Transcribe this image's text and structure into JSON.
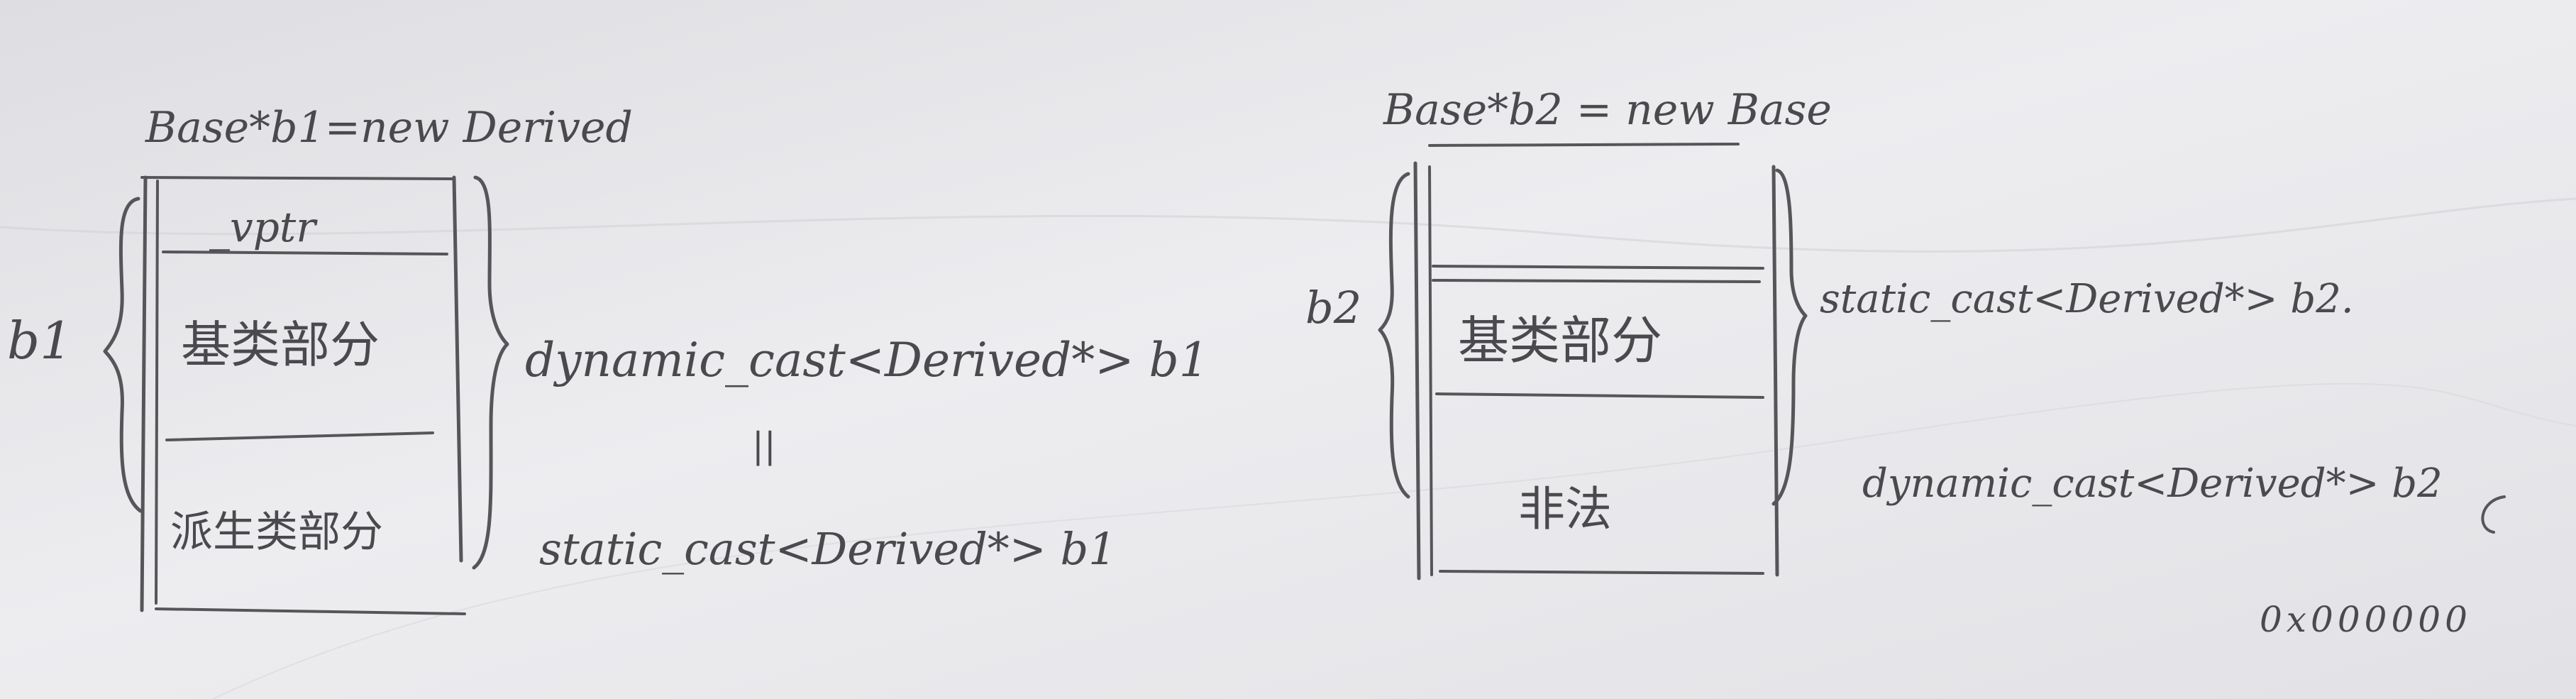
{
  "left": {
    "declaration": "Base*b1=new Derived",
    "pointer_name": "b1",
    "cells": [
      "_vptr",
      "基类部分",
      "派生类部分"
    ],
    "cast_top": "dynamic_cast<Derived*> b1",
    "equivalence": "||",
    "cast_bottom": "static_cast<Derived*> b1"
  },
  "right": {
    "declaration": "Base*b2 = new Base",
    "pointer_name": "b2",
    "cells": [
      "基类部分",
      "非法"
    ],
    "cast_top": "static_cast<Derived*> b2.",
    "cast_bottom": "dynamic_cast<Derived*> b2",
    "result": "0x000000"
  }
}
